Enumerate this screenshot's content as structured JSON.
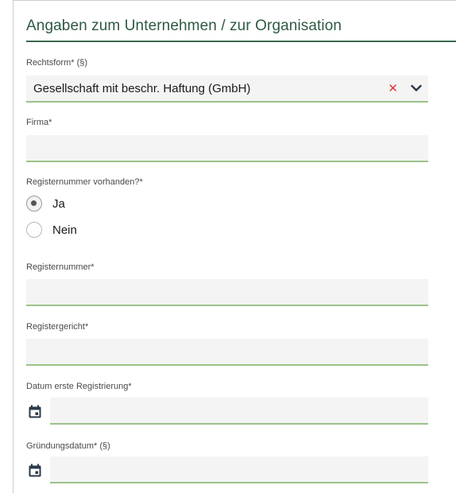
{
  "section": {
    "title": "Angaben zum Unternehmen / zur Organisation"
  },
  "fields": {
    "rechtsform": {
      "label": "Rechtsform* (§)",
      "value": "Gesellschaft mit beschr. Haftung (GmbH)"
    },
    "firma": {
      "label": "Firma*",
      "value": ""
    },
    "registernummer_vorhanden": {
      "label": "Registernummer vorhanden?*",
      "options": [
        {
          "label": "Ja",
          "selected": true
        },
        {
          "label": "Nein",
          "selected": false
        }
      ]
    },
    "registernummer": {
      "label": "Registernummer*",
      "value": ""
    },
    "registergericht": {
      "label": "Registergericht*",
      "value": ""
    },
    "datum_erste_registrierung": {
      "label": "Datum erste Registrierung*",
      "value": ""
    },
    "gruendungsdatum": {
      "label": "Gründungsdatum* (§)",
      "value": ""
    }
  },
  "icons": {
    "clear": "close-icon",
    "dropdown": "chevron-down-icon",
    "calendar": "calendar-icon"
  },
  "colors": {
    "title": "#2f5a43",
    "field_underline": "#9cc38a",
    "field_background": "#f3f4f3",
    "clear_icon": "#d9363e"
  }
}
